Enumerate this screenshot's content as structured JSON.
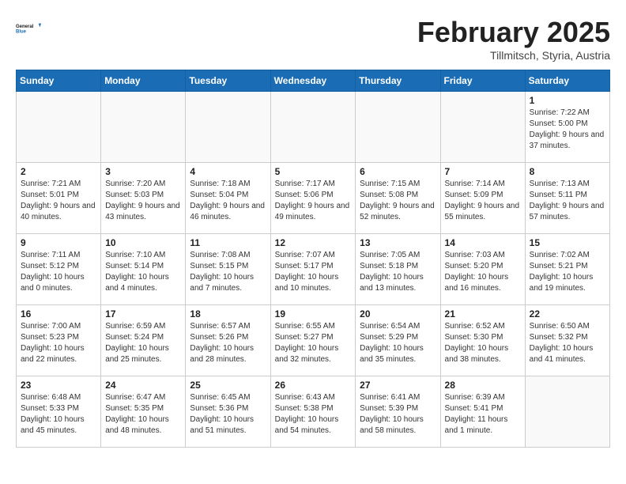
{
  "header": {
    "logo_line1": "General",
    "logo_line2": "Blue",
    "month_title": "February 2025",
    "location": "Tillmitsch, Styria, Austria"
  },
  "weekdays": [
    "Sunday",
    "Monday",
    "Tuesday",
    "Wednesday",
    "Thursday",
    "Friday",
    "Saturday"
  ],
  "weeks": [
    [
      {
        "day": "",
        "info": ""
      },
      {
        "day": "",
        "info": ""
      },
      {
        "day": "",
        "info": ""
      },
      {
        "day": "",
        "info": ""
      },
      {
        "day": "",
        "info": ""
      },
      {
        "day": "",
        "info": ""
      },
      {
        "day": "1",
        "info": "Sunrise: 7:22 AM\nSunset: 5:00 PM\nDaylight: 9 hours and 37 minutes."
      }
    ],
    [
      {
        "day": "2",
        "info": "Sunrise: 7:21 AM\nSunset: 5:01 PM\nDaylight: 9 hours and 40 minutes."
      },
      {
        "day": "3",
        "info": "Sunrise: 7:20 AM\nSunset: 5:03 PM\nDaylight: 9 hours and 43 minutes."
      },
      {
        "day": "4",
        "info": "Sunrise: 7:18 AM\nSunset: 5:04 PM\nDaylight: 9 hours and 46 minutes."
      },
      {
        "day": "5",
        "info": "Sunrise: 7:17 AM\nSunset: 5:06 PM\nDaylight: 9 hours and 49 minutes."
      },
      {
        "day": "6",
        "info": "Sunrise: 7:15 AM\nSunset: 5:08 PM\nDaylight: 9 hours and 52 minutes."
      },
      {
        "day": "7",
        "info": "Sunrise: 7:14 AM\nSunset: 5:09 PM\nDaylight: 9 hours and 55 minutes."
      },
      {
        "day": "8",
        "info": "Sunrise: 7:13 AM\nSunset: 5:11 PM\nDaylight: 9 hours and 57 minutes."
      }
    ],
    [
      {
        "day": "9",
        "info": "Sunrise: 7:11 AM\nSunset: 5:12 PM\nDaylight: 10 hours and 0 minutes."
      },
      {
        "day": "10",
        "info": "Sunrise: 7:10 AM\nSunset: 5:14 PM\nDaylight: 10 hours and 4 minutes."
      },
      {
        "day": "11",
        "info": "Sunrise: 7:08 AM\nSunset: 5:15 PM\nDaylight: 10 hours and 7 minutes."
      },
      {
        "day": "12",
        "info": "Sunrise: 7:07 AM\nSunset: 5:17 PM\nDaylight: 10 hours and 10 minutes."
      },
      {
        "day": "13",
        "info": "Sunrise: 7:05 AM\nSunset: 5:18 PM\nDaylight: 10 hours and 13 minutes."
      },
      {
        "day": "14",
        "info": "Sunrise: 7:03 AM\nSunset: 5:20 PM\nDaylight: 10 hours and 16 minutes."
      },
      {
        "day": "15",
        "info": "Sunrise: 7:02 AM\nSunset: 5:21 PM\nDaylight: 10 hours and 19 minutes."
      }
    ],
    [
      {
        "day": "16",
        "info": "Sunrise: 7:00 AM\nSunset: 5:23 PM\nDaylight: 10 hours and 22 minutes."
      },
      {
        "day": "17",
        "info": "Sunrise: 6:59 AM\nSunset: 5:24 PM\nDaylight: 10 hours and 25 minutes."
      },
      {
        "day": "18",
        "info": "Sunrise: 6:57 AM\nSunset: 5:26 PM\nDaylight: 10 hours and 28 minutes."
      },
      {
        "day": "19",
        "info": "Sunrise: 6:55 AM\nSunset: 5:27 PM\nDaylight: 10 hours and 32 minutes."
      },
      {
        "day": "20",
        "info": "Sunrise: 6:54 AM\nSunset: 5:29 PM\nDaylight: 10 hours and 35 minutes."
      },
      {
        "day": "21",
        "info": "Sunrise: 6:52 AM\nSunset: 5:30 PM\nDaylight: 10 hours and 38 minutes."
      },
      {
        "day": "22",
        "info": "Sunrise: 6:50 AM\nSunset: 5:32 PM\nDaylight: 10 hours and 41 minutes."
      }
    ],
    [
      {
        "day": "23",
        "info": "Sunrise: 6:48 AM\nSunset: 5:33 PM\nDaylight: 10 hours and 45 minutes."
      },
      {
        "day": "24",
        "info": "Sunrise: 6:47 AM\nSunset: 5:35 PM\nDaylight: 10 hours and 48 minutes."
      },
      {
        "day": "25",
        "info": "Sunrise: 6:45 AM\nSunset: 5:36 PM\nDaylight: 10 hours and 51 minutes."
      },
      {
        "day": "26",
        "info": "Sunrise: 6:43 AM\nSunset: 5:38 PM\nDaylight: 10 hours and 54 minutes."
      },
      {
        "day": "27",
        "info": "Sunrise: 6:41 AM\nSunset: 5:39 PM\nDaylight: 10 hours and 58 minutes."
      },
      {
        "day": "28",
        "info": "Sunrise: 6:39 AM\nSunset: 5:41 PM\nDaylight: 11 hours and 1 minute."
      },
      {
        "day": "",
        "info": ""
      }
    ]
  ]
}
